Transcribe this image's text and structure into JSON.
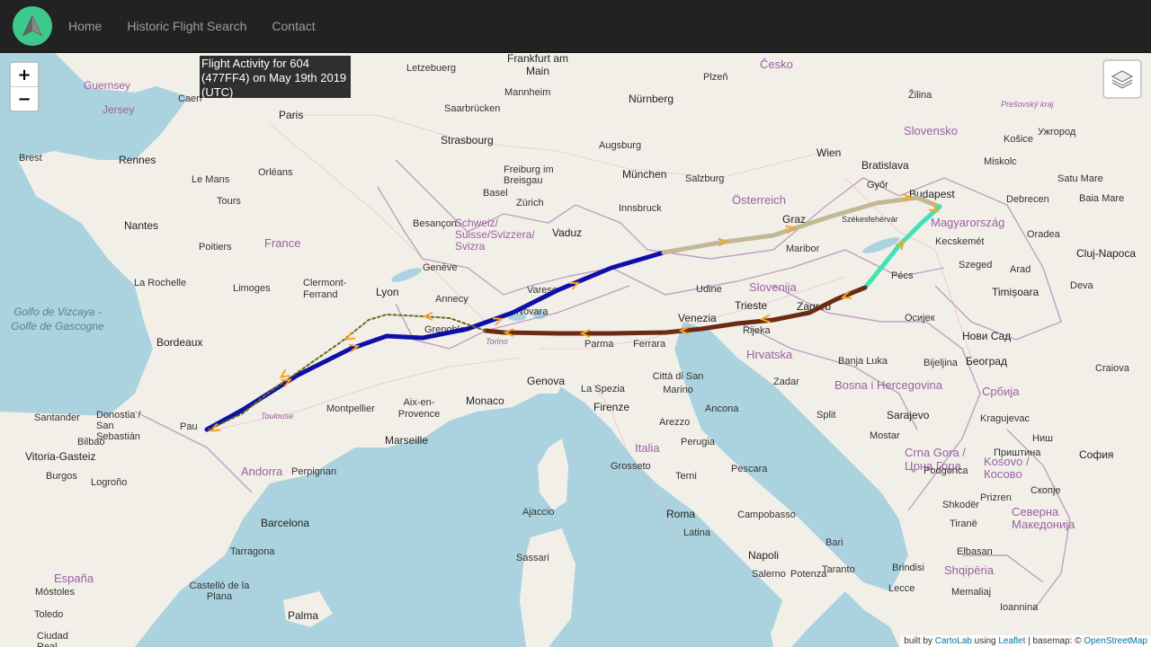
{
  "nav": {
    "links": [
      "Home",
      "Historic Flight Search",
      "Contact"
    ]
  },
  "map": {
    "title": "Flight Activity for 604 (477FF4) on May 19th 2019 (UTC)",
    "zoom_in": "+",
    "zoom_out": "−",
    "attribution": {
      "prefix": "built by",
      "cartolab": "CartoLab",
      "using": "using",
      "leaflet": "Leaflet",
      "basemap": "| basemap: ©",
      "osm": "OpenStreetMap"
    },
    "labels": {
      "countries": [
        "Česko",
        "France",
        "Schweiz/ Suisse/Svizzera/ Svizra",
        "Österreich",
        "Slovensko",
        "Magyarország",
        "Slovenija",
        "Hrvatska",
        "Italia",
        "Bosna i Hercegovina",
        "Србија",
        "España",
        "Andorra",
        "Crna Gora / Црна Гора",
        "Shqipëria",
        "Kosovo / Косово",
        "Северна Македонија"
      ],
      "seas": [
        "Golfo de Vizcaya - Golfe de Gascogne"
      ],
      "cities": [
        "Letzebuerg",
        "Frankfurt am Main",
        "Plzeň",
        "Mannheim",
        "Nürnberg",
        "Paris",
        "Saarbrücken",
        "Strasbourg",
        "Augsburg",
        "Rennes",
        "Brest",
        "Nantes",
        "Orléans",
        "Le Mans",
        "Tours",
        "Freiburg im Breisgau",
        "Basel",
        "Zürich",
        "München",
        "Salzburg",
        "Wien",
        "Bratislava",
        "Budapest",
        "Győr",
        "Székesfehérvár",
        "Kecskemét",
        "Debrecen",
        "Miskolc",
        "Košice",
        "Ужгород",
        "Satu Mare",
        "Baia Mare",
        "Oradea",
        "Cluj-Napoca",
        "Szeged",
        "Arad",
        "Timișoara",
        "Deva",
        "Нови Сад",
        "Осијек",
        "Београд",
        "Craiova",
        "Besançon",
        "Genève",
        "Annecy",
        "Lyon",
        "Grenoble",
        "Clermont-Ferrand",
        "Limoges",
        "Poitiers",
        "La Rochelle",
        "Bordeaux",
        "Vaduz",
        "Innsbruck",
        "Graz",
        "Maribor",
        "Pécs",
        "Zagreb",
        "Rijeka",
        "Trieste",
        "Venezia",
        "Udine",
        "Varese",
        "Novara",
        "Torino",
        "Genova",
        "Parma",
        "Ferrara",
        "Monaco",
        "Aix-en-Provence",
        "Marseille",
        "Montpellier",
        "Toulouse",
        "Pau",
        "Bilbao",
        "Donostia / San Sebastián",
        "Santander",
        "Vitoria-Gasteiz",
        "Burgos",
        "Logroño",
        "Perpignan",
        "Barcelona",
        "Tarragona",
        "Castelló de la Plana",
        "Móstoles",
        "Toledo",
        "Ciudad Real",
        "La Spezia",
        "Firenze",
        "Arezzo",
        "Perugia",
        "Ancona",
        "Città di San Marino",
        "Grosseto",
        "Terni",
        "Pescara",
        "Roma",
        "Latina",
        "Campobasso",
        "Napoli",
        "Salerno",
        "Potenza",
        "Taranto",
        "Brindisi",
        "Lecce",
        "Bari",
        "Ajaccio",
        "Sassari",
        "Palma",
        "Banja Luka",
        "Sarajevo",
        "Mostar",
        "Bijeljina",
        "Zadar",
        "Split",
        "Tiranë",
        "Elbasan",
        "Shkodër",
        "Podgorica",
        "Prizren",
        "Скопје",
        "Kragujevac",
        "Ниш",
        "София",
        "Приштина",
        "Memaliaj",
        "Ioannina",
        "Guernsey",
        "Jersey",
        "Caen",
        "Prešovský kraj",
        "Žilina"
      ]
    }
  },
  "colors": {
    "navbar_bg": "#222222",
    "nav_text": "#9d9d9d",
    "logo": "#3ec98a",
    "title_box_bg": "#141414",
    "route_blue": "#0e0ea8",
    "route_brown": "#6b2a12",
    "route_tan": "#c2b894",
    "route_teal": "#3fe3b6",
    "route_olive": "#6b6b1a",
    "arrow": "#f5a623",
    "water": "#aad3df",
    "land": "#f2efe9"
  },
  "icons": [
    "logo-icon",
    "zoom-in-icon",
    "zoom-out-icon",
    "layers-icon",
    "flight-direction-arrow-icon"
  ]
}
